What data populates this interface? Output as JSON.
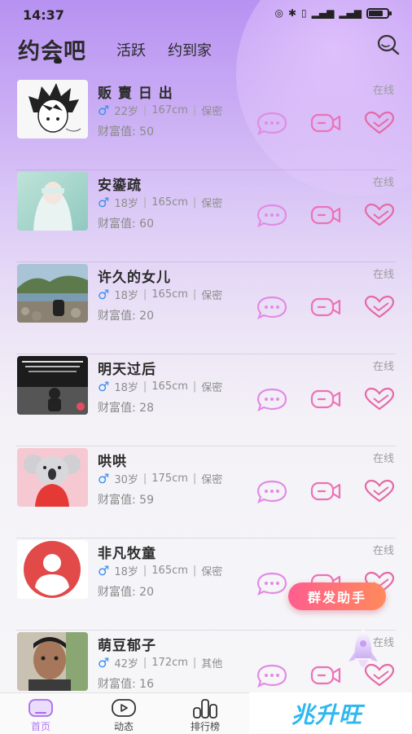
{
  "status_bar": {
    "time": "14:37"
  },
  "header": {
    "tabs": [
      "约会吧",
      "活跃",
      "约到家"
    ]
  },
  "users": [
    {
      "name": "贩 賣 日 出",
      "gender": "♂",
      "age": "22岁",
      "height": "167cm",
      "job": "保密",
      "wealth": "财富值: 50",
      "status": "在线"
    },
    {
      "name": "安鎏疏",
      "gender": "♂",
      "age": "18岁",
      "height": "165cm",
      "job": "保密",
      "wealth": "财富值: 60",
      "status": "在线"
    },
    {
      "name": "许久的女儿",
      "gender": "♂",
      "age": "18岁",
      "height": "165cm",
      "job": "保密",
      "wealth": "财富值: 20",
      "status": "在线"
    },
    {
      "name": "明天过后",
      "gender": "♂",
      "age": "18岁",
      "height": "165cm",
      "job": "保密",
      "wealth": "财富值: 28",
      "status": "在线"
    },
    {
      "name": "哄哄",
      "gender": "♂",
      "age": "30岁",
      "height": "175cm",
      "job": "保密",
      "wealth": "财富值: 59",
      "status": "在线"
    },
    {
      "name": "非凡牧童",
      "gender": "♂",
      "age": "18岁",
      "height": "165cm",
      "job": "保密",
      "wealth": "财富值: 20",
      "status": "在线"
    },
    {
      "name": "萌豆郁子",
      "gender": "♂",
      "age": "42岁",
      "height": "172cm",
      "job": "其他",
      "wealth": "财富值: 16",
      "status": "在线"
    }
  ],
  "floating": {
    "broadcast_label": "群发助手"
  },
  "bottom_nav": {
    "items": [
      "首页",
      "动态",
      "排行榜"
    ],
    "brand": "兆升旺"
  },
  "colors": {
    "accent": "#e070d8",
    "male": "#3a8ef0",
    "brand": "#2fb7f0"
  }
}
